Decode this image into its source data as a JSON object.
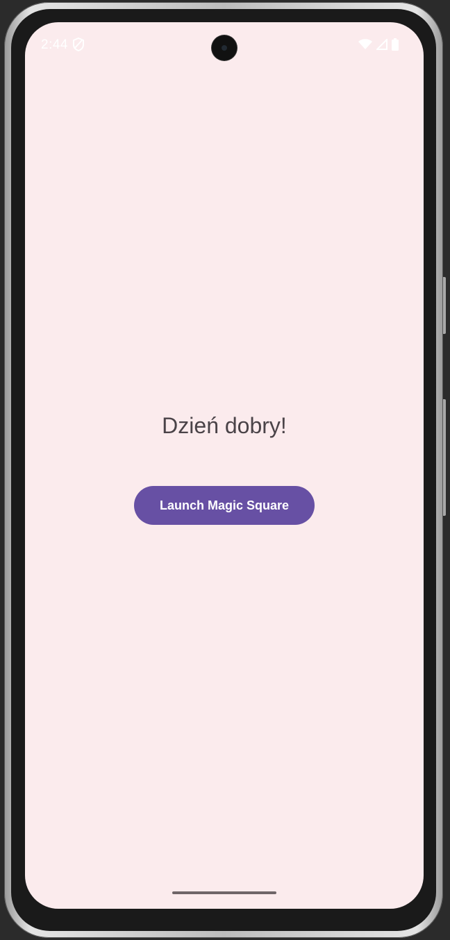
{
  "status_bar": {
    "time": "2:44",
    "icons": [
      "shield-icon",
      "wifi-icon",
      "signal-icon",
      "battery-icon"
    ]
  },
  "main": {
    "greeting": "Dzień dobry!",
    "launch_button_label": "Launch Magic Square"
  },
  "colors": {
    "background": "#fbebed",
    "button": "#6750a4",
    "button_text": "#ffffff",
    "greeting_text": "#4a4348"
  }
}
